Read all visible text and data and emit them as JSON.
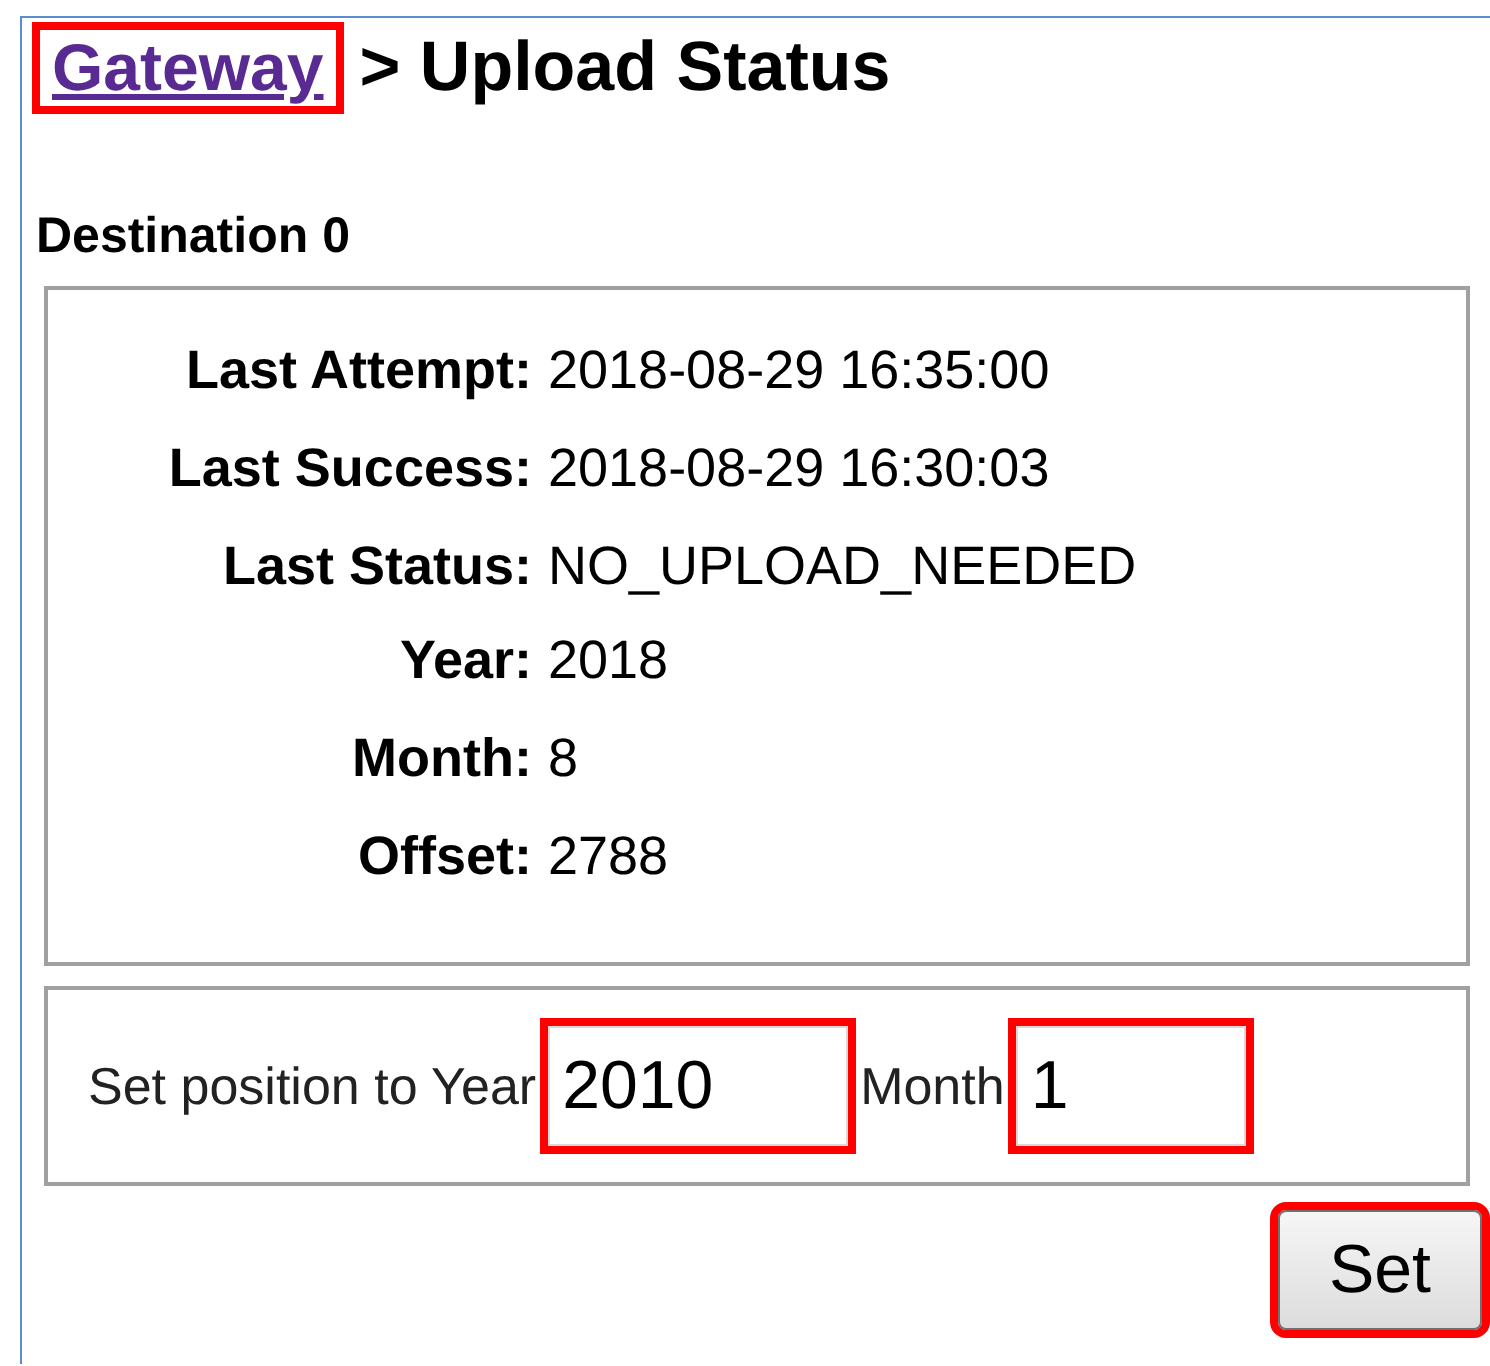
{
  "heading": {
    "link": {
      "label": "Gateway",
      "highlighted": true
    },
    "title": "> Upload Status"
  },
  "section_title": "Destination 0",
  "status_groups": [
    {
      "rows": [
        {
          "label": "Last Attempt:",
          "value": "2018-08-29 16:35:00"
        },
        {
          "label": "Last Success:",
          "value": "2018-08-29 16:30:03"
        },
        {
          "label": "Last Status:",
          "value": "NO_UPLOAD_NEEDED"
        }
      ]
    },
    {
      "rows": [
        {
          "label": "Year:",
          "value": "2018"
        },
        {
          "label": "Month:",
          "value": "8"
        },
        {
          "label": "Offset:",
          "value": "2788"
        }
      ]
    }
  ],
  "position_form": {
    "label": "Set position to Year",
    "year": {
      "value": "2010",
      "highlighted": true
    },
    "month_label": "Month",
    "month": {
      "value": "1",
      "highlighted": true
    }
  },
  "set_button": {
    "label": "Set",
    "highlighted": true
  }
}
